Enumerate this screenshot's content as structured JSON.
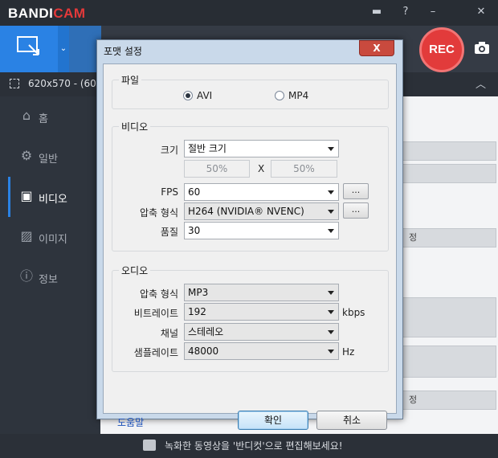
{
  "app": {
    "logo_part1": "BANDI",
    "logo_part2": "CAM",
    "colors": {
      "accent": "#2a82e4",
      "rec": "#e23b3b",
      "dialog_close": "#c94a3e"
    },
    "titlebar_icons": [
      "folder-icon",
      "help-icon",
      "minimize-icon",
      "close-icon"
    ]
  },
  "toolbar": {
    "rec_label": "REC",
    "icons": [
      "select-area-icon",
      "chevron-down-icon",
      "camera-icon"
    ]
  },
  "sizebar": {
    "size_text": "620x570 - (60…"
  },
  "sidebar": {
    "items": [
      {
        "label": "홈",
        "icon": "home-icon"
      },
      {
        "label": "일반",
        "icon": "gear-icon"
      },
      {
        "label": "비디오",
        "icon": "video-settings-icon",
        "active": true
      },
      {
        "label": "이미지",
        "icon": "image-icon"
      },
      {
        "label": "정보",
        "icon": "info-icon"
      }
    ]
  },
  "content": {
    "ghost_row_1": "정",
    "ghost_row_2": "정"
  },
  "status": {
    "text": "녹화한 동영상을 '반디컷'으로 편집해보세요!",
    "icon": "chat-icon"
  },
  "dialog": {
    "title": "포맷 설정",
    "close_glyph": "X",
    "file": {
      "group_label": "파일",
      "options": [
        {
          "label": "AVI",
          "selected": true
        },
        {
          "label": "MP4",
          "selected": false
        }
      ]
    },
    "video": {
      "group_label": "비디오",
      "size_label": "크기",
      "size_value": "절반 크기",
      "width_pct": "50%",
      "x_label": "X",
      "height_pct": "50%",
      "fps_label": "FPS",
      "fps_value": "60",
      "codec_label": "압축 형식",
      "codec_value": "H264 (NVIDIA® NVENC)",
      "quality_label": "품질",
      "quality_value": "30",
      "more_button": "..."
    },
    "audio": {
      "group_label": "오디오",
      "codec_label": "압축 형식",
      "codec_value": "MP3",
      "bitrate_label": "비트레이트",
      "bitrate_value": "192",
      "bitrate_unit": "kbps",
      "channel_label": "채널",
      "channel_value": "스테레오",
      "samplerate_label": "샘플레이트",
      "samplerate_value": "48000",
      "samplerate_unit": "Hz"
    },
    "help_link": "도움말",
    "ok_button": "확인",
    "cancel_button": "취소"
  }
}
